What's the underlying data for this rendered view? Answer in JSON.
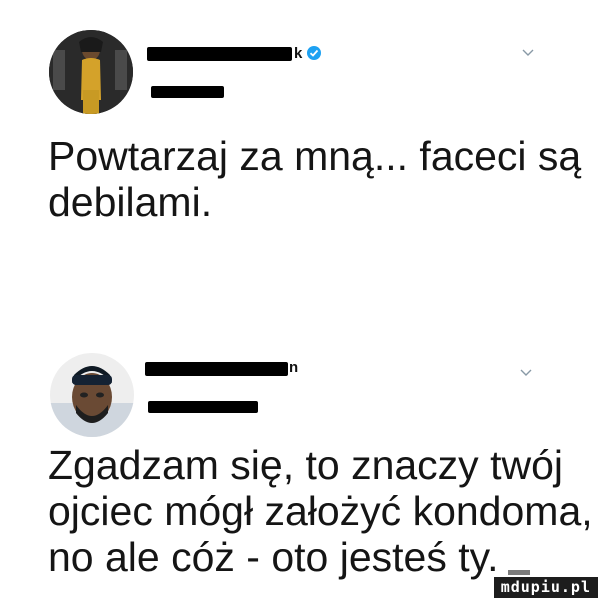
{
  "tweet1": {
    "name_visible": "k",
    "body_lines": [
      "Powtarzaj za mną... faceci są",
      "debilami."
    ]
  },
  "tweet2": {
    "name_visible": "n",
    "body_lines": [
      "Zgadzam się, to znaczy twój",
      "ojciec mógł założyć kondoma,",
      "no ale cóż - oto jesteś ty."
    ]
  },
  "watermark": "mdupiu.pl",
  "colors": {
    "verified": "#1da1f2",
    "redaction": "#000000",
    "chevron": "#8899a6"
  },
  "icons": [
    "verified-badge-icon",
    "chevron-down-icon"
  ]
}
